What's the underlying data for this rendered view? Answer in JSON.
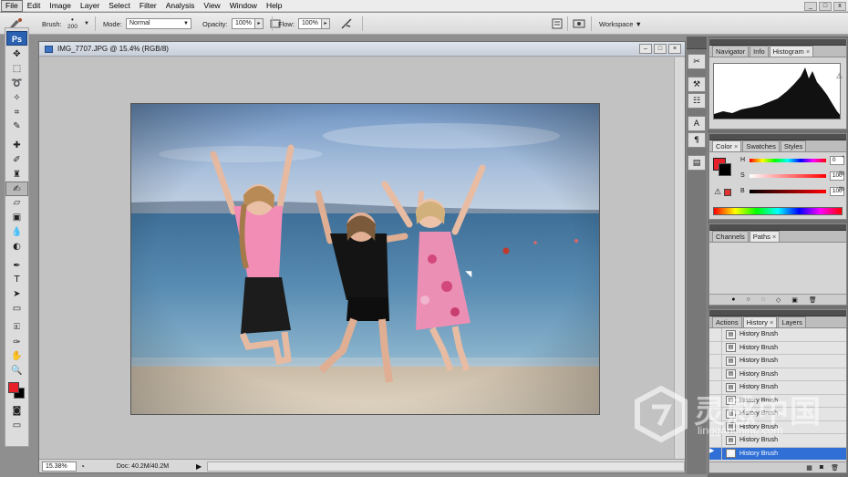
{
  "menubar": {
    "items": [
      "File",
      "Edit",
      "Image",
      "Layer",
      "Select",
      "Filter",
      "Analysis",
      "View",
      "Window",
      "Help"
    ],
    "window_controls": [
      "_",
      "□",
      "x"
    ]
  },
  "options": {
    "brush_label": "Brush:",
    "brush_size": "200",
    "mode_label": "Mode:",
    "mode_value": "Normal",
    "opacity_label": "Opacity:",
    "opacity_value": "100%",
    "flow_label": "Flow:",
    "flow_value": "100%",
    "workspace_label": "Workspace ▼"
  },
  "toolbar": {
    "logo": "Ps",
    "foreground_color": "#e8202a",
    "background_color": "#000000"
  },
  "document": {
    "title": "IMG_7707.JPG @ 15.4% (RGB/8)",
    "zoom": "15.38%",
    "doc_size": "Doc: 40.2M/40.2M"
  },
  "panels": {
    "navigator_tabs": [
      "Navigator",
      "Info",
      "Histogram"
    ],
    "color_tabs": [
      "Color",
      "Swatches",
      "Styles"
    ],
    "color_channels": [
      {
        "label": "H",
        "value": "0"
      },
      {
        "label": "S",
        "value": "100"
      },
      {
        "label": "B",
        "value": "100"
      }
    ],
    "color_units": [
      "°",
      "%",
      "%"
    ],
    "paths_tabs": [
      "Channels",
      "Paths"
    ],
    "history_tabs": [
      "Actions",
      "History",
      "Layers"
    ],
    "history_items": [
      "History Brush",
      "History Brush",
      "History Brush",
      "History Brush",
      "History Brush",
      "History Brush",
      "History Brush",
      "History Brush",
      "History Brush",
      "History Brush"
    ]
  },
  "watermark": {
    "text": "灵感中国",
    "url": "lingganchina.com"
  }
}
